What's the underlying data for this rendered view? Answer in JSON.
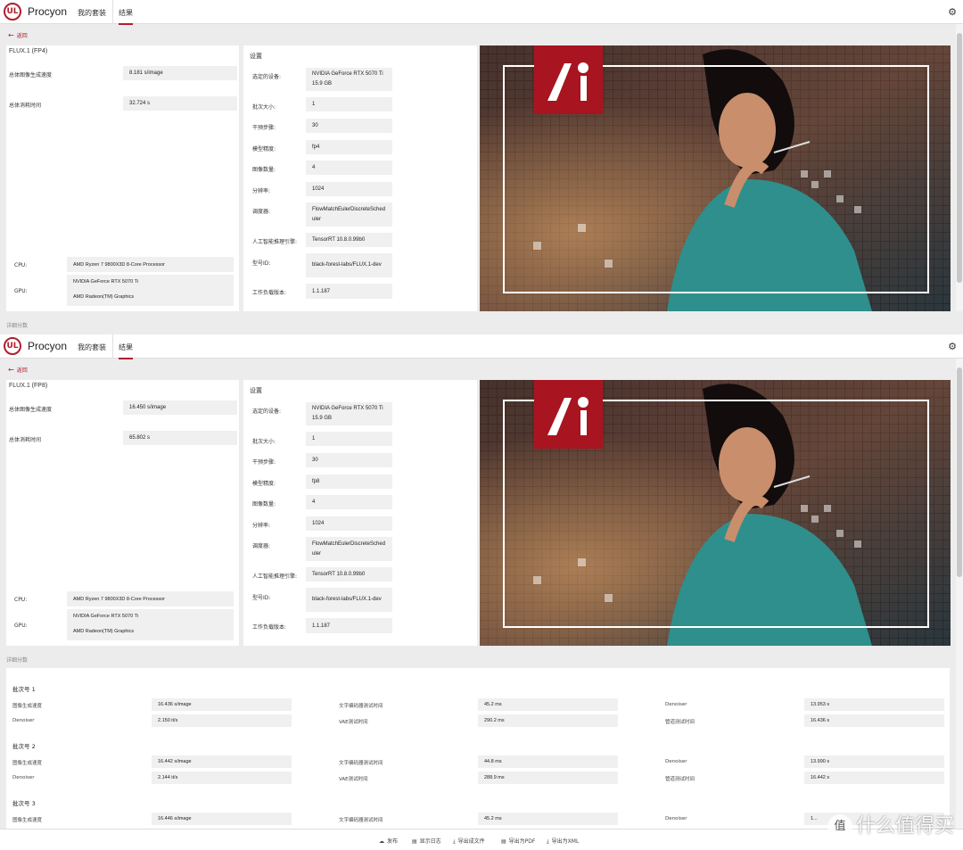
{
  "app": {
    "brand": "Procyon",
    "logo_text": "UL",
    "nav": [
      "我的套装",
      "结果"
    ],
    "back_label": "返回",
    "gear_icon": "gear-icon",
    "accent_color": "#b01e2e"
  },
  "runs": [
    {
      "test_name": "FLUX.1 (FP4)",
      "speed_label": "总体图像生成速度",
      "speed_value": "8.181 s/image",
      "time_label": "总体消耗时间",
      "time_value": "32.724 s",
      "cpu_label": "CPU:",
      "cpu_value": "AMD Ryzen 7 9800X3D 8-Core Processor",
      "gpu_label": "GPU:",
      "gpu_values": [
        "NVIDIA GeForce RTX 5070 Ti",
        "AMD Radeon(TM) Graphics"
      ],
      "settings_title": "设置",
      "settings": [
        {
          "label": "选定的设备:",
          "value": "NVIDIA GeForce RTX 5070 Ti 15.9 GB"
        },
        {
          "label": "批次大小:",
          "value": "1"
        },
        {
          "label": "干预步骤:",
          "value": "30"
        },
        {
          "label": "模型精度:",
          "value": "fp4"
        },
        {
          "label": "图像数量:",
          "value": "4"
        },
        {
          "label": "分辨率:",
          "value": "1024"
        },
        {
          "label": "调度器:",
          "value": "FlowMatchEulerDiscreteScheduler"
        },
        {
          "label": "人工智能推理引擎:",
          "value": "TensorRT 10.8.0.99b0"
        },
        {
          "label": "型号ID:",
          "value": "black-forest-labs/FLUX.1-dev"
        },
        {
          "label": "工作负载版本:",
          "value": "1.1.187"
        }
      ],
      "details_label": "详细分数"
    },
    {
      "test_name": "FLUX.1 (FP8)",
      "speed_label": "总体图像生成速度",
      "speed_value": "16.450 s/image",
      "time_label": "总体消耗时间",
      "time_value": "65.802 s",
      "cpu_label": "CPU:",
      "cpu_value": "AMD Ryzen 7 9800X3D 8-Core Processor",
      "gpu_label": "GPU:",
      "gpu_values": [
        "NVIDIA GeForce RTX 5070 Ti",
        "AMD Radeon(TM) Graphics"
      ],
      "settings_title": "设置",
      "settings": [
        {
          "label": "选定的设备:",
          "value": "NVIDIA GeForce RTX 5070 Ti 15.9 GB"
        },
        {
          "label": "批次大小:",
          "value": "1"
        },
        {
          "label": "干预步骤:",
          "value": "30"
        },
        {
          "label": "模型精度:",
          "value": "fp8"
        },
        {
          "label": "图像数量:",
          "value": "4"
        },
        {
          "label": "分辨率:",
          "value": "1024"
        },
        {
          "label": "调度器:",
          "value": "FlowMatchEulerDiscreteScheduler"
        },
        {
          "label": "人工智能推理引擎:",
          "value": "TensorRT 10.8.0.99b0"
        },
        {
          "label": "型号ID:",
          "value": "black-forest-labs/FLUX.1-dev"
        },
        {
          "label": "工作负载版本:",
          "value": "1.1.187"
        }
      ],
      "details_label": "详细分数"
    }
  ],
  "batches": [
    {
      "title": "批次号 1",
      "rows": [
        [
          {
            "label": "图像生成速度",
            "value": "16.436 s/image"
          },
          {
            "label": "文字编码器测试时间",
            "value": "45.2 ms"
          },
          {
            "label": "Denoiser",
            "value": "13.953 s"
          }
        ],
        [
          {
            "label": "Denoiser",
            "value": "2.150 it/s"
          },
          {
            "label": "VAE测试时间",
            "value": "290.2 ms"
          },
          {
            "label": "管道测试时间",
            "value": "16.436 s"
          }
        ]
      ]
    },
    {
      "title": "批次号 2",
      "rows": [
        [
          {
            "label": "图像生成速度",
            "value": "16.442 s/image"
          },
          {
            "label": "文字编码器测试时间",
            "value": "44.8 ms"
          },
          {
            "label": "Denoiser",
            "value": "13.990 s"
          }
        ],
        [
          {
            "label": "Denoiser",
            "value": "2.144 it/s"
          },
          {
            "label": "VAE测试时间",
            "value": "288.9 ms"
          },
          {
            "label": "管道测试时间",
            "value": "16.442 s"
          }
        ]
      ]
    },
    {
      "title": "批次号 3",
      "rows": [
        [
          {
            "label": "图像生成速度",
            "value": "16.446 s/image"
          },
          {
            "label": "文字编码器测试时间",
            "value": "45.2 ms"
          },
          {
            "label": "Denoiser",
            "value": "1..."
          }
        ]
      ]
    }
  ],
  "footer": [
    {
      "icon": "publish-icon",
      "label": "发布"
    },
    {
      "icon": "log-icon",
      "label": "显示日志"
    },
    {
      "icon": "export-file-icon",
      "label": "导出成文件"
    },
    {
      "icon": "export-pdf-icon",
      "label": "导出为PDF"
    },
    {
      "icon": "export-xml-icon",
      "label": "导出为XML"
    }
  ],
  "watermark": {
    "badge": "值",
    "text": "什么值得买"
  }
}
